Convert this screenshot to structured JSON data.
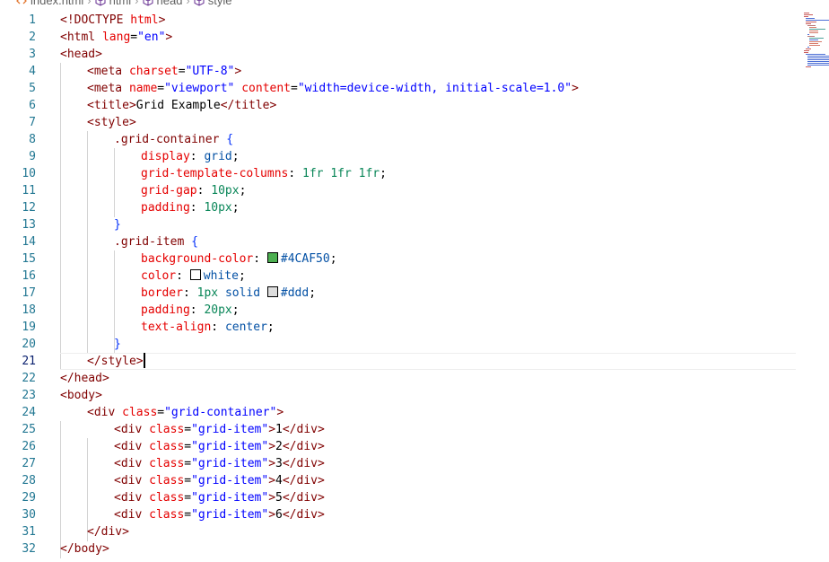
{
  "breadcrumb": {
    "items": [
      {
        "label": "index.html",
        "icon": "html-file-icon"
      },
      {
        "label": "html",
        "icon": "cube-icon"
      },
      {
        "label": "head",
        "icon": "cube-icon"
      },
      {
        "label": "style",
        "icon": "cube-icon"
      }
    ]
  },
  "editor": {
    "active_line": 21,
    "lines": [
      {
        "n": 1,
        "indent": 0,
        "tokens": [
          [
            "tag",
            "<!DOCTYPE "
          ],
          [
            "attr",
            "html"
          ],
          [
            "tag",
            ">"
          ]
        ]
      },
      {
        "n": 2,
        "indent": 0,
        "tokens": [
          [
            "tag",
            "<html "
          ],
          [
            "attr",
            "lang"
          ],
          [
            "punc",
            "="
          ],
          [
            "str",
            "\"en\""
          ],
          [
            "tag",
            ">"
          ]
        ]
      },
      {
        "n": 3,
        "indent": 0,
        "tokens": [
          [
            "tag",
            "<head>"
          ]
        ]
      },
      {
        "n": 4,
        "indent": 1,
        "tokens": [
          [
            "tag",
            "<meta "
          ],
          [
            "attr",
            "charset"
          ],
          [
            "punc",
            "="
          ],
          [
            "str",
            "\"UTF-8\""
          ],
          [
            "tag",
            ">"
          ]
        ]
      },
      {
        "n": 5,
        "indent": 1,
        "tokens": [
          [
            "tag",
            "<meta "
          ],
          [
            "attr",
            "name"
          ],
          [
            "punc",
            "="
          ],
          [
            "str",
            "\"viewport\""
          ],
          [
            "text",
            " "
          ],
          [
            "attr",
            "content"
          ],
          [
            "punc",
            "="
          ],
          [
            "str",
            "\"width=device-width, initial-scale=1.0\""
          ],
          [
            "tag",
            ">"
          ]
        ]
      },
      {
        "n": 6,
        "indent": 1,
        "tokens": [
          [
            "tag",
            "<title>"
          ],
          [
            "text",
            "Grid Example"
          ],
          [
            "tag",
            "</title>"
          ]
        ]
      },
      {
        "n": 7,
        "indent": 1,
        "tokens": [
          [
            "tag",
            "<style>"
          ]
        ]
      },
      {
        "n": 8,
        "indent": 2,
        "tokens": [
          [
            "sel",
            ".grid-container"
          ],
          [
            "text",
            " "
          ],
          [
            "brace",
            "{"
          ]
        ]
      },
      {
        "n": 9,
        "indent": 3,
        "tokens": [
          [
            "prop",
            "display"
          ],
          [
            "punc",
            ": "
          ],
          [
            "val",
            "grid"
          ],
          [
            "punc",
            ";"
          ]
        ]
      },
      {
        "n": 10,
        "indent": 3,
        "tokens": [
          [
            "prop",
            "grid-template-columns"
          ],
          [
            "punc",
            ": "
          ],
          [
            "num",
            "1fr 1fr 1fr"
          ],
          [
            "punc",
            ";"
          ]
        ]
      },
      {
        "n": 11,
        "indent": 3,
        "tokens": [
          [
            "prop",
            "grid-gap"
          ],
          [
            "punc",
            ": "
          ],
          [
            "num",
            "10px"
          ],
          [
            "punc",
            ";"
          ]
        ]
      },
      {
        "n": 12,
        "indent": 3,
        "tokens": [
          [
            "prop",
            "padding"
          ],
          [
            "punc",
            ": "
          ],
          [
            "num",
            "10px"
          ],
          [
            "punc",
            ";"
          ]
        ]
      },
      {
        "n": 13,
        "indent": 2,
        "tokens": [
          [
            "brace",
            "}"
          ]
        ]
      },
      {
        "n": 14,
        "indent": 2,
        "tokens": [
          [
            "sel",
            ".grid-item"
          ],
          [
            "text",
            " "
          ],
          [
            "brace",
            "{"
          ]
        ]
      },
      {
        "n": 15,
        "indent": 3,
        "tokens": [
          [
            "prop",
            "background-color"
          ],
          [
            "punc",
            ": "
          ],
          [
            "swatch",
            "#4CAF50"
          ],
          [
            "val",
            "#4CAF50"
          ],
          [
            "punc",
            ";"
          ]
        ]
      },
      {
        "n": 16,
        "indent": 3,
        "tokens": [
          [
            "prop",
            "color"
          ],
          [
            "punc",
            ": "
          ],
          [
            "swatch",
            "#ffffff"
          ],
          [
            "val",
            "white"
          ],
          [
            "punc",
            ";"
          ]
        ]
      },
      {
        "n": 17,
        "indent": 3,
        "tokens": [
          [
            "prop",
            "border"
          ],
          [
            "punc",
            ": "
          ],
          [
            "num",
            "1px"
          ],
          [
            "text",
            " "
          ],
          [
            "val",
            "solid"
          ],
          [
            "text",
            " "
          ],
          [
            "swatch",
            "#dddddd"
          ],
          [
            "val",
            "#ddd"
          ],
          [
            "punc",
            ";"
          ]
        ]
      },
      {
        "n": 18,
        "indent": 3,
        "tokens": [
          [
            "prop",
            "padding"
          ],
          [
            "punc",
            ": "
          ],
          [
            "num",
            "20px"
          ],
          [
            "punc",
            ";"
          ]
        ]
      },
      {
        "n": 19,
        "indent": 3,
        "tokens": [
          [
            "prop",
            "text-align"
          ],
          [
            "punc",
            ": "
          ],
          [
            "val",
            "center"
          ],
          [
            "punc",
            ";"
          ]
        ]
      },
      {
        "n": 20,
        "indent": 2,
        "tokens": [
          [
            "brace",
            "}"
          ]
        ]
      },
      {
        "n": 21,
        "indent": 1,
        "tokens": [
          [
            "tag",
            "</style>"
          ],
          [
            "cursor",
            ""
          ]
        ]
      },
      {
        "n": 22,
        "indent": 0,
        "tokens": [
          [
            "tag",
            "</head>"
          ]
        ]
      },
      {
        "n": 23,
        "indent": 0,
        "tokens": [
          [
            "tag",
            "<body>"
          ]
        ]
      },
      {
        "n": 24,
        "indent": 1,
        "tokens": [
          [
            "tag",
            "<div "
          ],
          [
            "attr",
            "class"
          ],
          [
            "punc",
            "="
          ],
          [
            "str",
            "\"grid-container\""
          ],
          [
            "tag",
            ">"
          ]
        ]
      },
      {
        "n": 25,
        "indent": 2,
        "tokens": [
          [
            "tag",
            "<div "
          ],
          [
            "attr",
            "class"
          ],
          [
            "punc",
            "="
          ],
          [
            "str",
            "\"grid-item\""
          ],
          [
            "tag",
            ">"
          ],
          [
            "text",
            "1"
          ],
          [
            "tag",
            "</div>"
          ]
        ]
      },
      {
        "n": 26,
        "indent": 2,
        "tokens": [
          [
            "tag",
            "<div "
          ],
          [
            "attr",
            "class"
          ],
          [
            "punc",
            "="
          ],
          [
            "str",
            "\"grid-item\""
          ],
          [
            "tag",
            ">"
          ],
          [
            "text",
            "2"
          ],
          [
            "tag",
            "</div>"
          ]
        ]
      },
      {
        "n": 27,
        "indent": 2,
        "tokens": [
          [
            "tag",
            "<div "
          ],
          [
            "attr",
            "class"
          ],
          [
            "punc",
            "="
          ],
          [
            "str",
            "\"grid-item\""
          ],
          [
            "tag",
            ">"
          ],
          [
            "text",
            "3"
          ],
          [
            "tag",
            "</div>"
          ]
        ]
      },
      {
        "n": 28,
        "indent": 2,
        "tokens": [
          [
            "tag",
            "<div "
          ],
          [
            "attr",
            "class"
          ],
          [
            "punc",
            "="
          ],
          [
            "str",
            "\"grid-item\""
          ],
          [
            "tag",
            ">"
          ],
          [
            "text",
            "4"
          ],
          [
            "tag",
            "</div>"
          ]
        ]
      },
      {
        "n": 29,
        "indent": 2,
        "tokens": [
          [
            "tag",
            "<div "
          ],
          [
            "attr",
            "class"
          ],
          [
            "punc",
            "="
          ],
          [
            "str",
            "\"grid-item\""
          ],
          [
            "tag",
            ">"
          ],
          [
            "text",
            "5"
          ],
          [
            "tag",
            "</div>"
          ]
        ]
      },
      {
        "n": 30,
        "indent": 2,
        "tokens": [
          [
            "tag",
            "<div "
          ],
          [
            "attr",
            "class"
          ],
          [
            "punc",
            "="
          ],
          [
            "str",
            "\"grid-item\""
          ],
          [
            "tag",
            ">"
          ],
          [
            "text",
            "6"
          ],
          [
            "tag",
            "</div>"
          ]
        ]
      },
      {
        "n": 31,
        "indent": 1,
        "tokens": [
          [
            "tag",
            "</div>"
          ]
        ]
      },
      {
        "n": 32,
        "indent": 0,
        "tokens": [
          [
            "tag",
            "</body>"
          ]
        ]
      }
    ]
  }
}
